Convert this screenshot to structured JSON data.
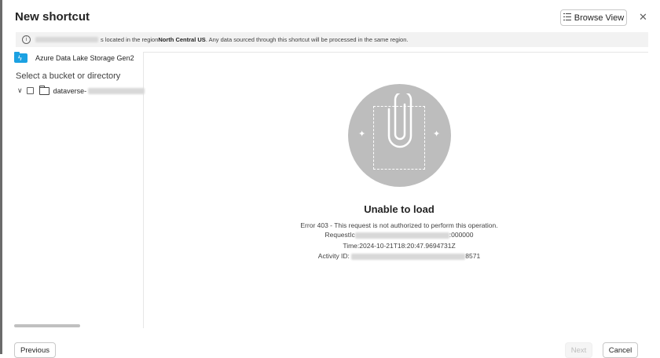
{
  "dialog": {
    "title": "New shortcut",
    "browse_view_label": "Browse View",
    "close_glyph": "✕"
  },
  "banner": {
    "text_prefix": "s located in the region ",
    "region": "North Central US",
    "text_suffix": ". Any data sourced through this shortcut will be processed in the same region."
  },
  "sidebar": {
    "source_name": "Azure Data Lake Storage Gen2",
    "select_label": "Select a bucket or directory",
    "tree": [
      {
        "label": "dataverse-",
        "expanded": true,
        "checked": false
      }
    ]
  },
  "content": {
    "heading": "Unable to load",
    "error_message": "Error 403 - This request is not authorized to perform this operation.",
    "request_prefix": "RequestIc",
    "request_suffix": ":000000",
    "time_text": "Time:2024-10-21T18:20:47.9694731Z",
    "activity_prefix": "Activity ID: ",
    "activity_suffix": "8571"
  },
  "footer": {
    "previous_label": "Previous",
    "next_label": "Next",
    "next_disabled": true,
    "cancel_label": "Cancel"
  },
  "colors": {
    "accent": "#1ba1e2",
    "banner_bg": "#f2f2f2",
    "illustration_bg": "#bdbdbd"
  }
}
